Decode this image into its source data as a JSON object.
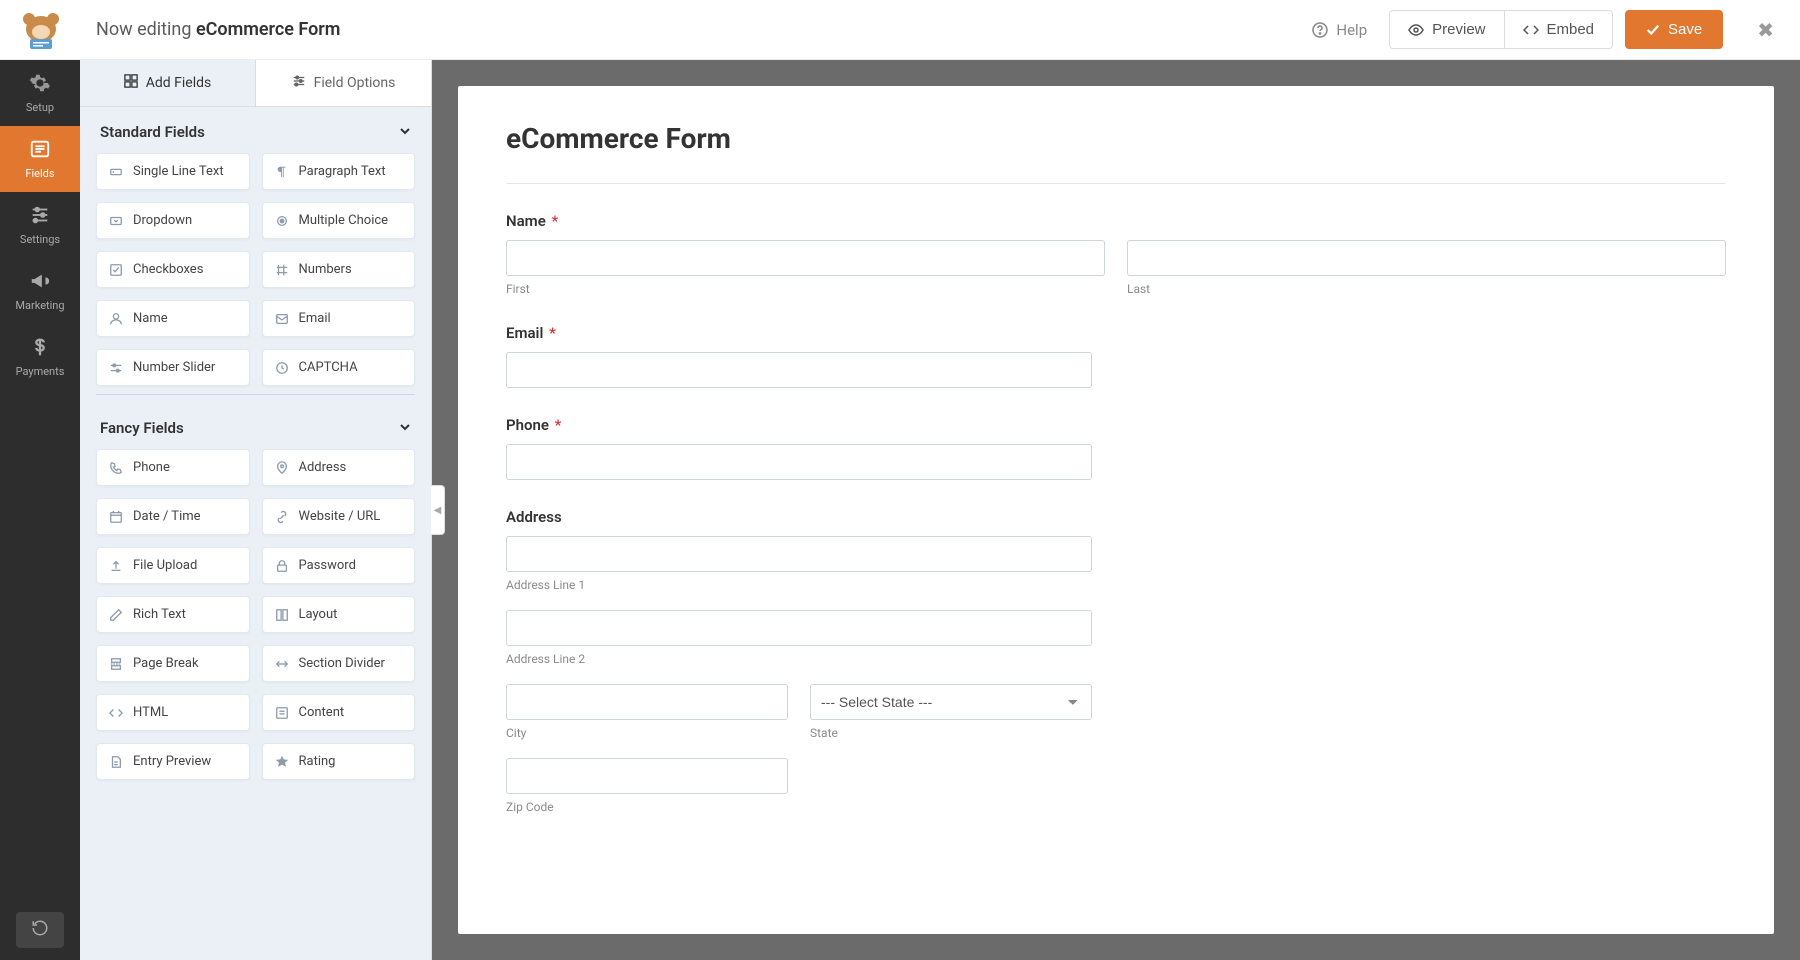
{
  "header": {
    "editing_prefix": "Now editing ",
    "editing_title": "eCommerce Form",
    "help": "Help",
    "preview": "Preview",
    "embed": "Embed",
    "save": "Save"
  },
  "leftnav": {
    "setup": "Setup",
    "fields": "Fields",
    "settings": "Settings",
    "marketing": "Marketing",
    "payments": "Payments"
  },
  "sidebar": {
    "tab_add": "Add Fields",
    "tab_options": "Field Options",
    "standard_header": "Standard Fields",
    "fancy_header": "Fancy Fields",
    "standard": {
      "single_line": "Single Line Text",
      "paragraph": "Paragraph Text",
      "dropdown": "Dropdown",
      "multiple_choice": "Multiple Choice",
      "checkboxes": "Checkboxes",
      "numbers": "Numbers",
      "name": "Name",
      "email": "Email",
      "number_slider": "Number Slider",
      "captcha": "CAPTCHA"
    },
    "fancy": {
      "phone": "Phone",
      "address": "Address",
      "date_time": "Date / Time",
      "website": "Website / URL",
      "file_upload": "File Upload",
      "password": "Password",
      "rich_text": "Rich Text",
      "layout": "Layout",
      "page_break": "Page Break",
      "section_divider": "Section Divider",
      "html": "HTML",
      "content": "Content",
      "entry_preview": "Entry Preview",
      "rating": "Rating"
    }
  },
  "form": {
    "title": "eCommerce Form",
    "name_label": "Name",
    "first": "First",
    "last": "Last",
    "email_label": "Email",
    "phone_label": "Phone",
    "address_label": "Address",
    "addr1": "Address Line 1",
    "addr2": "Address Line 2",
    "city": "City",
    "state": "State",
    "state_placeholder": "--- Select State ---",
    "zip": "Zip Code"
  }
}
